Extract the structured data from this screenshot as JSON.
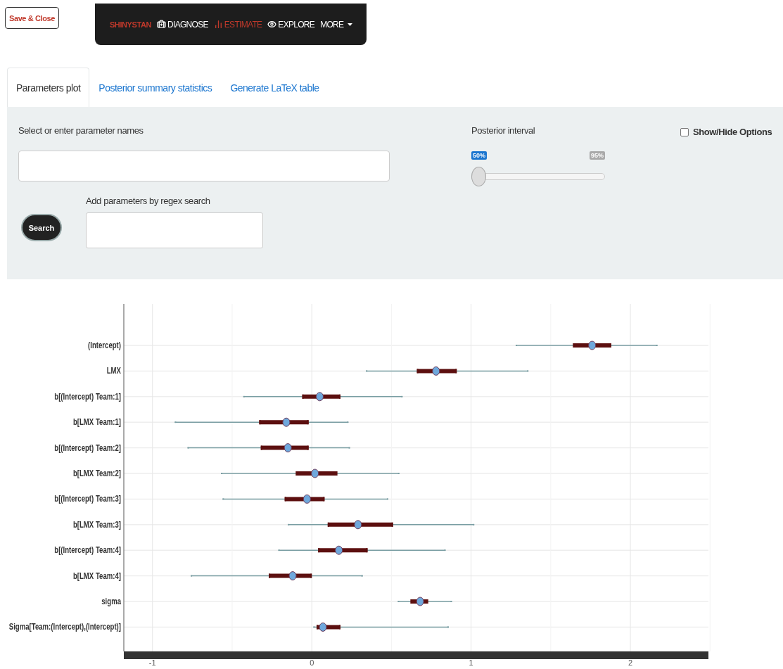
{
  "save_button": "Save & Close",
  "navbar": {
    "brand": "SHINYSTAN",
    "items": [
      {
        "label": "DIAGNOSE",
        "selected": false
      },
      {
        "label": "ESTIMATE",
        "selected": true
      },
      {
        "label": "EXPLORE",
        "selected": false
      }
    ],
    "more": "MORE"
  },
  "tabs": [
    {
      "label": "Parameters plot",
      "selected": true
    },
    {
      "label": "Posterior summary statistics",
      "selected": false
    },
    {
      "label": "Generate LaTeX table",
      "selected": false
    }
  ],
  "panel": {
    "parameter_label": "Select or enter parameter names",
    "posterior_interval": {
      "label": "Posterior interval",
      "value_label": "50%",
      "max_label": "95%",
      "level": 0
    },
    "show_hide": {
      "label": "Show/Hide Options",
      "checked": false
    },
    "regex": {
      "label": "Add parameters by regex search",
      "button": "Search"
    }
  },
  "chart_data": {
    "type": "scatter",
    "orientation": "horizontal",
    "grid": true,
    "xlim": [
      -1.18,
      2.49
    ],
    "xticks": [
      -1,
      0,
      1,
      2
    ],
    "categories": [
      "(Intercept)",
      "LMX",
      "b[(Intercept) Team:1]",
      "b[LMX Team:1]",
      "b[(Intercept) Team:2]",
      "b[LMX Team:2]",
      "b[(Intercept) Team:3]",
      "b[LMX Team:3]",
      "b[(Intercept) Team:4]",
      "b[LMX Team:4]",
      "sigma",
      "Sigma[Team:(Intercept),(Intercept)]"
    ],
    "series": [
      {
        "color": "#6fa8dc",
        "values": [
          1.76,
          0.78,
          0.05,
          -0.16,
          -0.15,
          0.02,
          -0.03,
          0.29,
          0.17,
          -0.12,
          0.68,
          0.07
        ]
      },
      {
        "color": "#5c0f0f",
        "values": [
          1.64,
          0.66,
          -0.06,
          -0.33,
          -0.32,
          -0.1,
          -0.17,
          0.1,
          0.04,
          -0.27,
          0.62,
          0.03
        ]
      },
      {
        "color": "#5c0f0f",
        "values": [
          1.88,
          0.91,
          0.18,
          -0.02,
          -0.02,
          0.16,
          0.08,
          0.51,
          0.35,
          0.0,
          0.73,
          0.18
        ]
      },
      {
        "color": "#7a9ea3",
        "values": [
          1.28,
          0.34,
          -0.43,
          -0.86,
          -0.78,
          -0.57,
          -0.56,
          -0.15,
          -0.21,
          -0.76,
          0.54,
          0.01
        ]
      },
      {
        "color": "#7a9ea3",
        "values": [
          2.17,
          1.36,
          0.57,
          0.23,
          0.24,
          0.55,
          0.48,
          1.02,
          0.84,
          0.32,
          0.88,
          0.86
        ]
      }
    ]
  }
}
